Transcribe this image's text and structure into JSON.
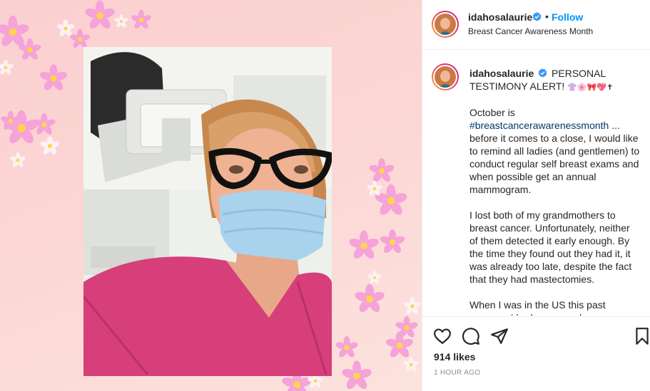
{
  "post": {
    "username": "idahosalaurie",
    "follow_label": "Follow",
    "separator": "•",
    "subtitle": "Breast Cancer Awareness Month",
    "caption": {
      "username": "idahosalaurie",
      "headline": "PERSONAL TESTIMONY ALERT!",
      "emoji": "👚🌸🎀💖✝",
      "paragraph1_lead": "October is",
      "hashtag": "#breastcancerawarenessmonth",
      "paragraph1_rest": "... before it comes to a close, I would like to remind all ladies (and gentlemen) to conduct regular self breast exams and when possible get an annual mammogram.",
      "paragraph2": "I lost both of my grandmothers to breast cancer. Unfortunately, neither of them detected it early enough. By the time they found out they had it, it was already too late, despite the fact that they had mastectomies.",
      "paragraph3": "When I was in the US this past summer, I had my annual"
    },
    "likes": "914 likes",
    "timestamp": "1 HOUR AGO"
  },
  "icons": {
    "like": "heart-outline-icon",
    "comment": "comment-bubble-icon",
    "share": "paper-plane-icon",
    "save": "bookmark-icon",
    "verified": "verified-badge-icon"
  },
  "colors": {
    "follow": "#0095f6",
    "hashtag": "#00376b",
    "verified": "#3897f0",
    "frame_pink": "#fbd6d4",
    "scrub_pink": "#d63f7a"
  }
}
